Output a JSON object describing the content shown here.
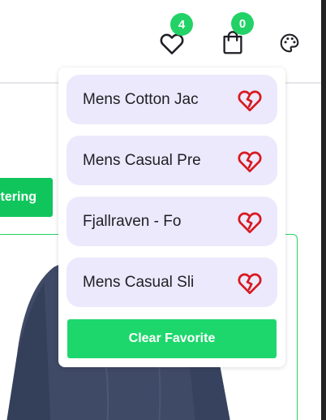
{
  "header": {
    "wishlist_count": "4",
    "cart_count": "0",
    "icons": [
      "heart-icon",
      "shopping-bag-icon",
      "palette-icon"
    ]
  },
  "filter_button": {
    "label": "tering"
  },
  "favorites": {
    "items": [
      {
        "label": "Mens Cotton Jac"
      },
      {
        "label": "Mens Casual Pre"
      },
      {
        "label": "Fjallraven - Fo"
      },
      {
        "label": "Mens Casual Sli"
      }
    ],
    "clear_label": "Clear Favorite"
  },
  "colors": {
    "accent_green": "#1ed76c",
    "item_bg": "#ebe9fb",
    "remove_icon": "#d71920"
  }
}
